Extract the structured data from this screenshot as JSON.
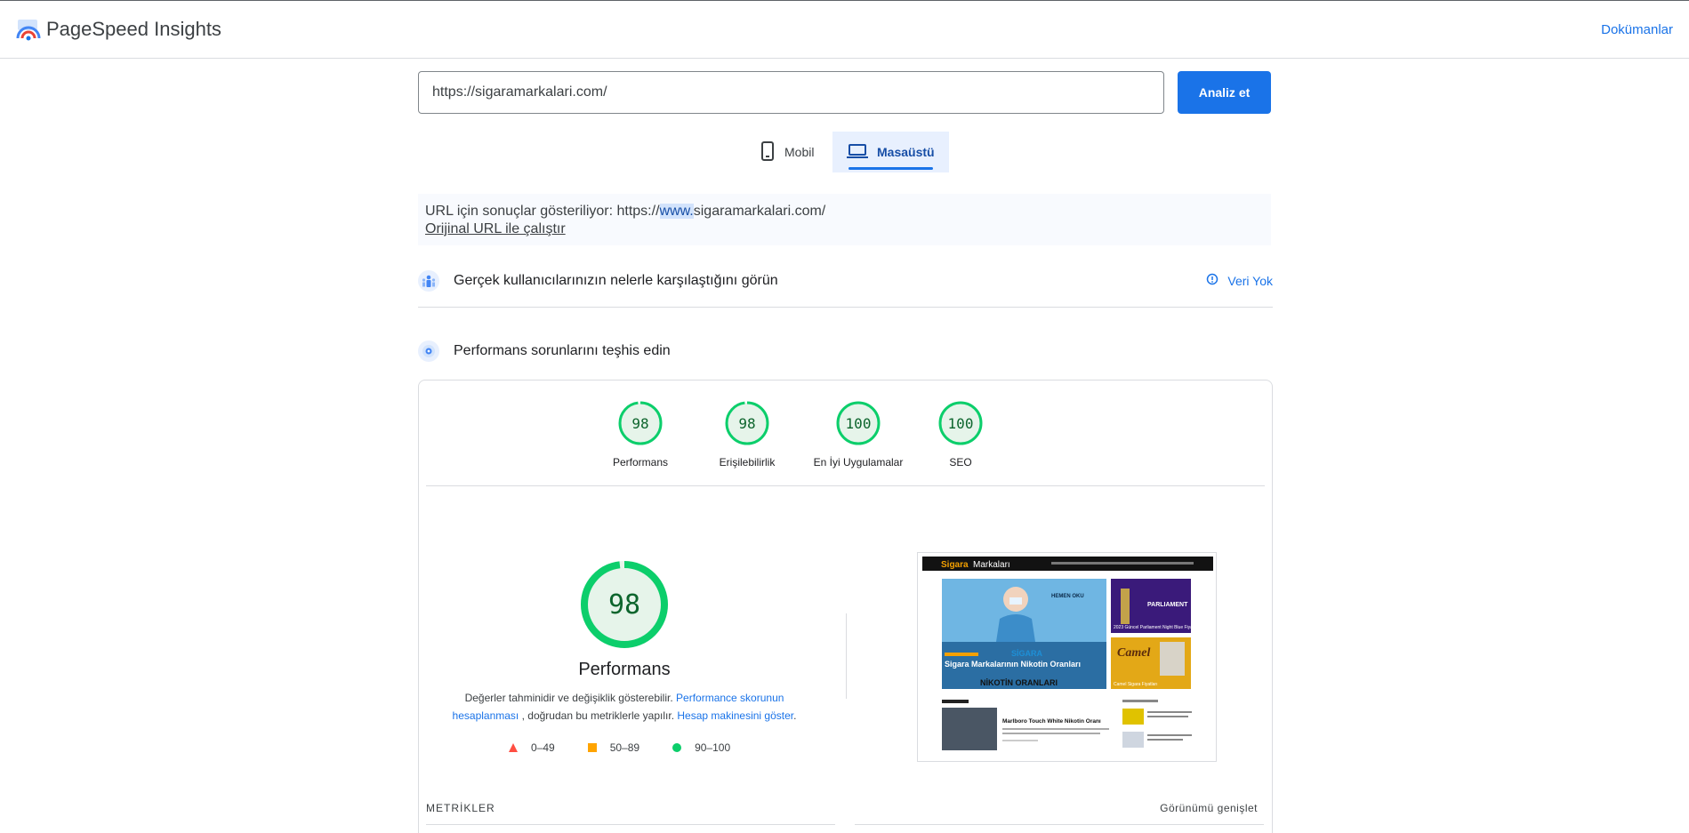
{
  "header": {
    "brand": "PageSpeed Insights",
    "docs_link": "Dokümanlar"
  },
  "search": {
    "url_value": "https://sigaramarkalari.com/",
    "analyze_label": "Analiz et"
  },
  "device_tabs": [
    {
      "label": "Mobil",
      "icon": "phone-icon",
      "selected": false
    },
    {
      "label": "Masaüstü",
      "icon": "laptop-icon",
      "selected": true
    }
  ],
  "notice": {
    "prefix": "URL için sonuçlar gösteriliyor: https://",
    "highlight": "www.",
    "suffix": "sigaramarkalari.com/",
    "rerun_link": "Orijinal URL ile çalıştır"
  },
  "crux": {
    "title": "Gerçek kullanıcılarınızın nelerle karşılaştığını görün",
    "status": "Veri Yok"
  },
  "diagnose": {
    "title": "Performans sorunlarını teşhis edin"
  },
  "scores": [
    {
      "value": "98",
      "label": "Performans",
      "fraction": 0.98
    },
    {
      "value": "98",
      "label": "Erişilebilirlik",
      "fraction": 0.98
    },
    {
      "value": "100",
      "label": "En İyi Uygulamalar",
      "fraction": 1.0
    },
    {
      "value": "100",
      "label": "SEO",
      "fraction": 1.0
    }
  ],
  "performance": {
    "score": "98",
    "fraction": 0.98,
    "title": "Performans",
    "desc_1": "Değerler tahminidir ve değişiklik gösterebilir.",
    "desc_link_1": "Performance skorunun hesaplanması",
    "desc_2": ", doğrudan bu metriklerle yapılır.",
    "desc_link_2": "Hesap makinesini göster",
    "desc_end": "."
  },
  "legend": [
    {
      "range": "0–49",
      "shape": "triangle",
      "color": "#ff4e42"
    },
    {
      "range": "50–89",
      "shape": "square",
      "color": "#ffa400"
    },
    {
      "range": "90–100",
      "shape": "circle",
      "color": "#0cce6b"
    }
  ],
  "screenshot": {
    "site_brand_a": "Sigara",
    "site_brand_b": "Markaları",
    "hero_badge": "HEMEN OKU",
    "hero_tag": "SİGARA",
    "hero_title": "Sigara Markalarının Nikotin Oranları",
    "hero_sub": "NİKOTİN ORANLARI",
    "side_1_title": "PARLIAMENT",
    "side_1_caption": "2023 Güncel Parliament Night Blue Fiyatı Kaç TL?",
    "side_2_title": "Camel",
    "side_2_caption": "Camel Sigara Fiyatları",
    "post_title": "Marlboro Touch White Nikotin Oranı"
  },
  "colors": {
    "accent": "#1a73e8",
    "pass": "#0cce6b",
    "pass_text": "#0d652d",
    "pass_bg": "#e6f4ea"
  },
  "metrics": {
    "label": "METRİKLER",
    "expand": "Görünümü genişlet"
  }
}
